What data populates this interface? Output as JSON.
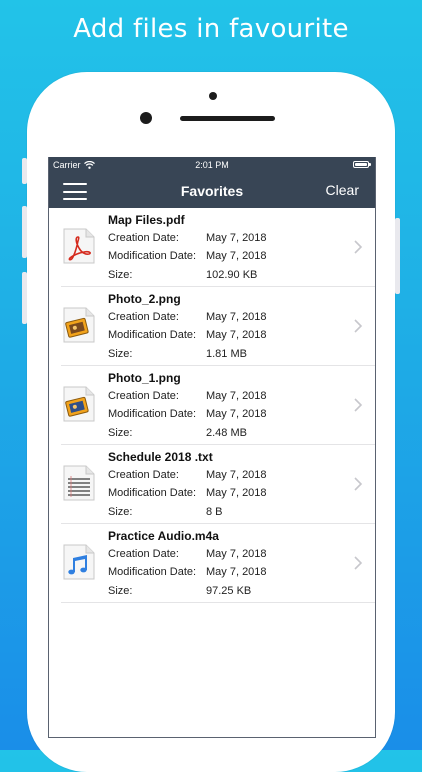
{
  "headline": "Add files in favourite",
  "status_bar": {
    "carrier": "Carrier",
    "time": "2:01 PM"
  },
  "nav": {
    "title": "Favorites",
    "clear_label": "Clear"
  },
  "labels": {
    "creation": "Creation Date:",
    "modification": "Modification Date:",
    "size": "Size:"
  },
  "files": [
    {
      "name": "Map Files.pdf",
      "creation": "May 7, 2018",
      "modification": "May 7, 2018",
      "size": "102.90 KB",
      "icon": "pdf-file-icon"
    },
    {
      "name": "Photo_2.png",
      "creation": "May 7, 2018",
      "modification": "May 7, 2018",
      "size": "1.81 MB",
      "icon": "image-file-icon"
    },
    {
      "name": "Photo_1.png",
      "creation": "May 7, 2018",
      "modification": "May 7, 2018",
      "size": "2.48 MB",
      "icon": "image-file-icon"
    },
    {
      "name": "Schedule 2018 .txt",
      "creation": "May 7, 2018",
      "modification": "May 7, 2018",
      "size": "8 B",
      "icon": "text-file-icon"
    },
    {
      "name": "Practice Audio.m4a",
      "creation": "May 7, 2018",
      "modification": "May 7, 2018",
      "size": "97.25 KB",
      "icon": "audio-file-icon"
    }
  ],
  "colors": {
    "background_top": "#22c3e8",
    "background_bottom": "#1a8ee8",
    "navbar": "#384555",
    "pdf_red": "#d52b1e"
  }
}
